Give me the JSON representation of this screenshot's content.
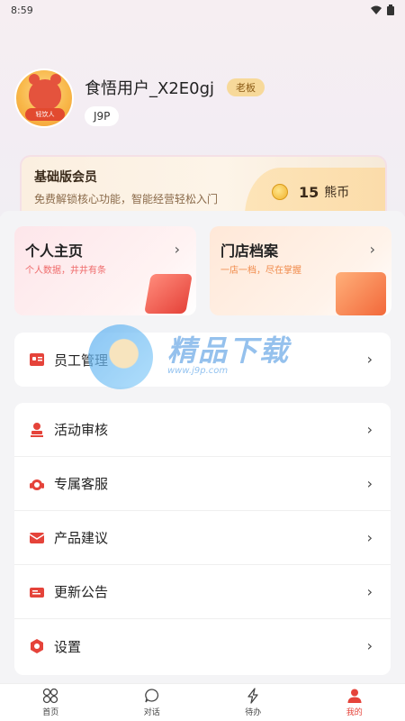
{
  "status_bar": {
    "time": "8:59",
    "wifi_icon": "wifi-icon",
    "battery_icon": "battery-icon"
  },
  "profile": {
    "avatar_label": "轻饮人",
    "username": "食悟用户_X2E0gj",
    "role_badge": "老板",
    "store_code": "J9P"
  },
  "membership": {
    "title": "基础版会员",
    "description": "免费解锁核心功能，智能经营轻松入门",
    "coins": "15",
    "coin_unit": "熊币"
  },
  "tiles": [
    {
      "title": "个人主页",
      "subtitle": "个人数据，井井有条"
    },
    {
      "title": "门店档案",
      "subtitle": "一店一档，尽在掌握"
    }
  ],
  "staff_card": {
    "label": "员工管理",
    "icon": "staff-id-icon"
  },
  "menu": [
    {
      "label": "活动审核",
      "icon": "stamp-icon"
    },
    {
      "label": "专属客服",
      "icon": "headset-icon"
    },
    {
      "label": "产品建议",
      "icon": "mail-icon"
    },
    {
      "label": "更新公告",
      "icon": "announcement-icon"
    },
    {
      "label": "设置",
      "icon": "gear-icon"
    }
  ],
  "bottom_nav": [
    {
      "label": "首页",
      "icon": "home-grid-icon",
      "active": false
    },
    {
      "label": "对话",
      "icon": "chat-icon",
      "active": false
    },
    {
      "label": "待办",
      "icon": "lightning-icon",
      "active": false
    },
    {
      "label": "我的",
      "icon": "person-icon",
      "active": true
    }
  ],
  "watermark": {
    "brand": "精品下载",
    "url": "www.j9p.com"
  },
  "colors": {
    "accent": "#e5433a",
    "badge_bg": "#f7d99a",
    "coin_bg": "#fde4b8"
  }
}
